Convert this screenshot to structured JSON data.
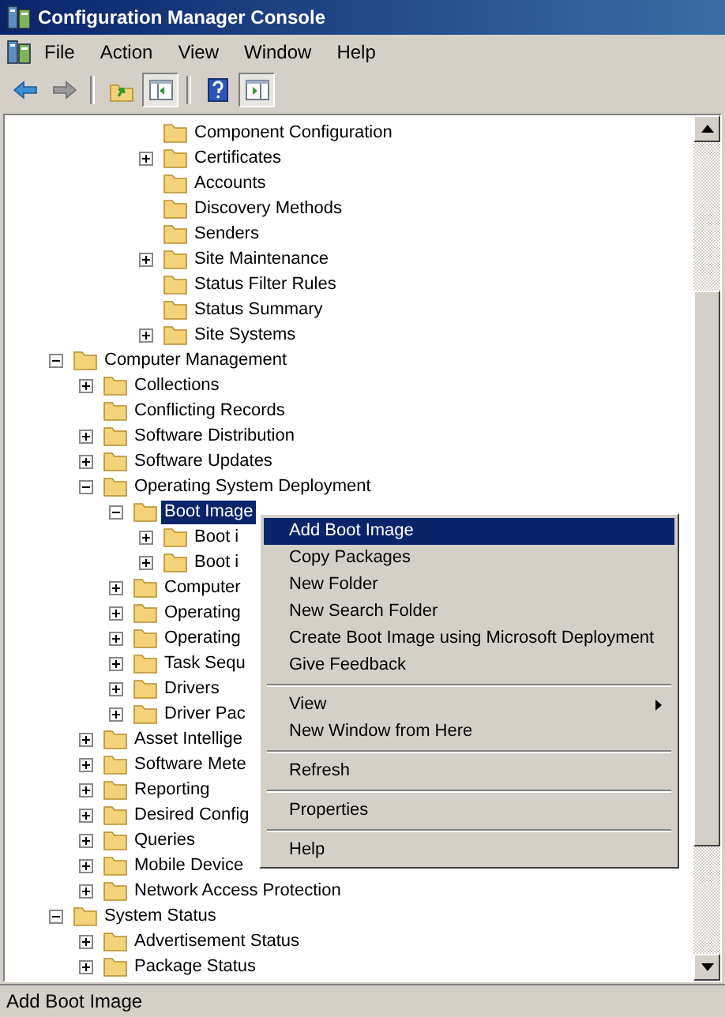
{
  "window": {
    "title": "Configuration Manager Console"
  },
  "menu_bar": [
    {
      "label": "File"
    },
    {
      "label": "Action"
    },
    {
      "label": "View"
    },
    {
      "label": "Window"
    },
    {
      "label": "Help"
    }
  ],
  "toolbar": [
    {
      "kind": "back",
      "disabled": false,
      "pressed": false
    },
    {
      "kind": "forward",
      "disabled": true,
      "pressed": false
    },
    {
      "kind": "separator"
    },
    {
      "kind": "up-folder",
      "pressed": false
    },
    {
      "kind": "console-tree",
      "pressed": true
    },
    {
      "kind": "separator"
    },
    {
      "kind": "help",
      "pressed": false
    },
    {
      "kind": "action-pane",
      "pressed": true
    }
  ],
  "tree": {
    "items": [
      {
        "children": [
          {
            "children": [
              {
                "children": [
                  {
                    "label": "Component Configuration",
                    "selected": false
                  },
                  {
                    "label": "Certificates",
                    "expanded": false,
                    "selected": false
                  },
                  {
                    "label": "Accounts",
                    "selected": false
                  },
                  {
                    "label": "Discovery Methods",
                    "selected": false
                  },
                  {
                    "label": "Senders",
                    "selected": false
                  },
                  {
                    "label": "Site Maintenance",
                    "expanded": false,
                    "selected": false
                  },
                  {
                    "label": "Status Filter Rules",
                    "selected": false
                  },
                  {
                    "label": "Status Summary",
                    "selected": false
                  },
                  {
                    "label": "Site Systems",
                    "expanded": false,
                    "selected": false
                  }
                ]
              }
            ]
          }
        ]
      },
      {
        "label": "Computer Management",
        "expanded": true,
        "selected": false,
        "children": [
          {
            "label": "Collections",
            "expanded": false,
            "selected": false
          },
          {
            "label": "Conflicting Records",
            "selected": false
          },
          {
            "label": "Software Distribution",
            "expanded": false,
            "selected": false
          },
          {
            "label": "Software Updates",
            "expanded": false,
            "selected": false
          },
          {
            "label": "Operating System Deployment",
            "expanded": true,
            "selected": false,
            "children": [
              {
                "label": "Boot Image",
                "expanded": true,
                "selected": true,
                "children": [
                  {
                    "label": "Boot i",
                    "expanded": false,
                    "selected": false
                  },
                  {
                    "label": "Boot i",
                    "expanded": false,
                    "selected": false
                  }
                ]
              },
              {
                "label": "Computer",
                "expanded": false,
                "selected": false
              },
              {
                "label": "Operating",
                "expanded": false,
                "selected": false
              },
              {
                "label": "Operating",
                "expanded": false,
                "selected": false
              },
              {
                "label": "Task Sequ",
                "expanded": false,
                "selected": false
              },
              {
                "label": "Drivers",
                "expanded": false,
                "selected": false
              },
              {
                "label": "Driver Pac",
                "expanded": false,
                "selected": false
              }
            ]
          },
          {
            "label": "Asset Intellige",
            "expanded": false,
            "selected": false
          },
          {
            "label": "Software Mete",
            "expanded": false,
            "selected": false
          },
          {
            "label": "Reporting",
            "expanded": false,
            "selected": false
          },
          {
            "label": "Desired Config",
            "expanded": false,
            "selected": false
          },
          {
            "label": "Queries",
            "expanded": false,
            "selected": false
          },
          {
            "label": "Mobile Device",
            "expanded": false,
            "selected": false
          },
          {
            "label": "Network Access Protection",
            "expanded": false,
            "selected": false
          }
        ]
      },
      {
        "label": "System Status",
        "expanded": true,
        "selected": false,
        "children": [
          {
            "label": "Advertisement Status",
            "expanded": false,
            "selected": false
          },
          {
            "label": "Package Status",
            "expanded": false,
            "selected": false
          }
        ]
      }
    ]
  },
  "context_menu": [
    {
      "kind": "item",
      "label": "Add Boot Image",
      "selected": true,
      "submenu": false
    },
    {
      "kind": "item",
      "label": "Copy Packages",
      "selected": false,
      "submenu": false
    },
    {
      "kind": "item",
      "label": "New Folder",
      "selected": false,
      "submenu": false
    },
    {
      "kind": "item",
      "label": "New Search Folder",
      "selected": false,
      "submenu": false
    },
    {
      "kind": "item",
      "label": "Create Boot Image using Microsoft Deployment",
      "selected": false,
      "submenu": false
    },
    {
      "kind": "item",
      "label": "Give Feedback",
      "selected": false,
      "submenu": false
    },
    {
      "kind": "separator"
    },
    {
      "kind": "item",
      "label": "View",
      "selected": false,
      "submenu": true
    },
    {
      "kind": "item",
      "label": "New Window from Here",
      "selected": false,
      "submenu": false
    },
    {
      "kind": "separator"
    },
    {
      "kind": "item",
      "label": "Refresh",
      "selected": false,
      "submenu": false
    },
    {
      "kind": "separator"
    },
    {
      "kind": "item",
      "label": "Properties",
      "selected": false,
      "submenu": false
    },
    {
      "kind": "separator"
    },
    {
      "kind": "item",
      "label": "Help",
      "selected": false,
      "submenu": false
    }
  ],
  "status_bar": {
    "text": "Add Boot Image"
  }
}
